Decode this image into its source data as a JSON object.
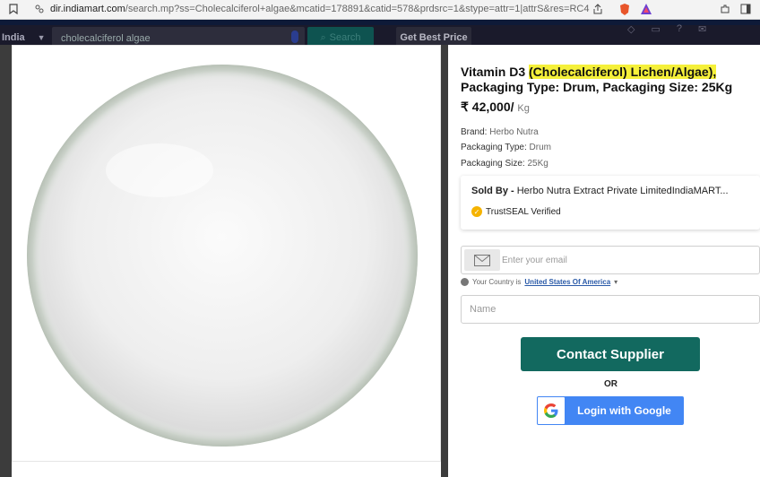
{
  "browser": {
    "url_host": "dir.indiamart.com",
    "url_path": "/search.mp?ss=Cholecalciferol+algae&mcatid=178891&catid=578&prdsrc=1&stype=attr=1|attrS&res=RC4"
  },
  "site_header": {
    "country": "India",
    "search_value": "cholecalciferol algae",
    "search_button": "Search",
    "best_price_button": "Get Best Price"
  },
  "product": {
    "title_plain": "Vitamin D3 ",
    "title_highlight": "(Cholecalciferol) Lichen/Algae),",
    "title_rest": "Packaging Type: Drum, Packaging Size: 25Kg",
    "price": "₹ 42,000/",
    "price_unit": "Kg",
    "specs": [
      {
        "label": "Brand:",
        "value": "Herbo Nutra"
      },
      {
        "label": "Packaging Type:",
        "value": "Drum"
      },
      {
        "label": "Packaging Size:",
        "value": "25Kg"
      }
    ]
  },
  "seller": {
    "sold_by_label": "Sold By - ",
    "sold_by_name": "Herbo Nutra Extract Private LimitedIndiaMART...",
    "trust_label": "TrustSEAL Verified"
  },
  "form": {
    "email_placeholder": "Enter your email",
    "country_prefix": "Your Country is",
    "country_value": "United States Of America",
    "name_placeholder": "Name",
    "contact_button": "Contact Supplier",
    "or_text": "OR",
    "google_button": "Login with Google"
  },
  "colors": {
    "contact_button": "#12695f",
    "google_button": "#4286f4",
    "highlight": "#f5f03a"
  }
}
